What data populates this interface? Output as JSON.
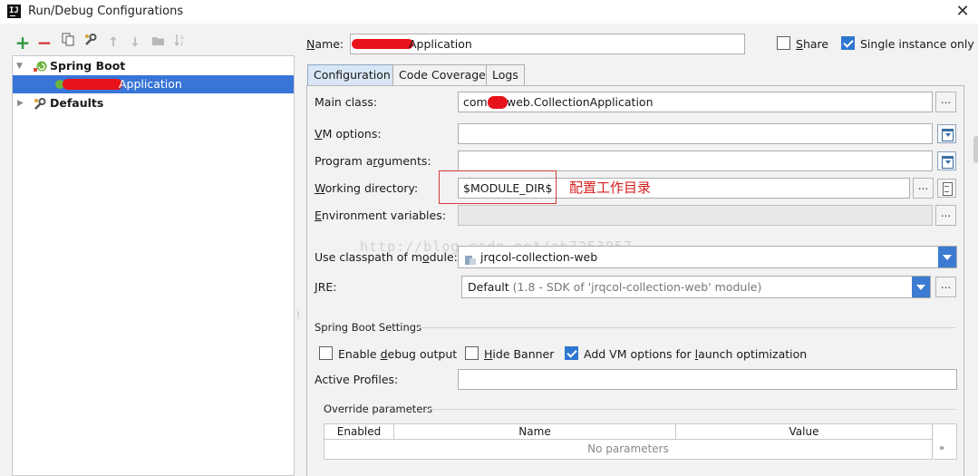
{
  "window": {
    "title": "Run/Debug Configurations",
    "close_glyph": "✕"
  },
  "toolbar": {
    "add_glyph": "+",
    "remove_glyph": "−",
    "up_glyph": "↑",
    "down_glyph": "↓"
  },
  "tree": {
    "spring_boot": "Spring Boot",
    "app_item": "Application",
    "defaults": "Defaults"
  },
  "name_field": {
    "label": "Name:",
    "value": "Application"
  },
  "share": {
    "label": "Share",
    "checked": false
  },
  "single_instance": {
    "label": "Single instance only",
    "checked": true
  },
  "tabs": [
    {
      "label": "Configuration",
      "active": true
    },
    {
      "label": "Code Coverage",
      "active": false
    },
    {
      "label": "Logs",
      "active": false
    }
  ],
  "form": {
    "main_class": {
      "label": "Main class:",
      "value": "com.",
      "value_suffix": "web.CollectionApplication"
    },
    "vm_options": {
      "label": "VM options:",
      "value": ""
    },
    "program_arguments": {
      "label": "Program arguments:",
      "value": ""
    },
    "working_directory": {
      "label": "Working directory:",
      "value": "$MODULE_DIR$"
    },
    "environment_variables": {
      "label": "Environment variables:",
      "value": ""
    },
    "classpath_module": {
      "label": "Use classpath of module:",
      "value": "jrqcol-collection-web"
    },
    "jre": {
      "label": "JRE:",
      "value": "Default",
      "value_detail": "(1.8 - SDK of 'jrqcol-collection-web' module)"
    },
    "dots": "..."
  },
  "spring_boot_settings": {
    "title": "Spring Boot Settings",
    "enable_debug": {
      "label": "Enable debug output",
      "checked": false
    },
    "hide_banner": {
      "label": "Hide Banner",
      "checked": false
    },
    "add_vm_options": {
      "label": "Add VM options for launch optimization",
      "checked": true
    },
    "active_profiles": {
      "label": "Active Profiles:",
      "value": ""
    }
  },
  "override_parameters": {
    "title": "Override parameters",
    "columns": [
      "Enabled",
      "Name",
      "Value"
    ],
    "empty_text": "No parameters",
    "more_glyph": "»"
  },
  "annotation": {
    "text": "配置工作目录",
    "color": "#d62020"
  },
  "watermark": "http://blog.csdn.net/ab7253957",
  "colors": {
    "accent": "#3875d7",
    "checkbox": "#2f77d1",
    "redaction": "#e8121b"
  }
}
